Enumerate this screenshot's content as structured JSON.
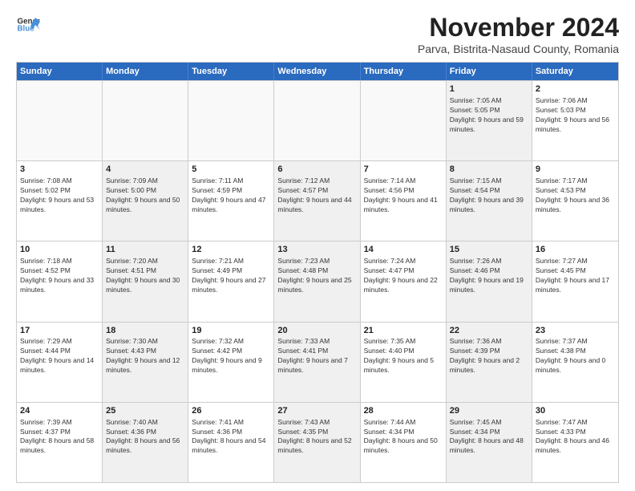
{
  "logo": {
    "line1": "General",
    "line2": "Blue"
  },
  "title": "November 2024",
  "subtitle": "Parva, Bistrita-Nasaud County, Romania",
  "header_days": [
    "Sunday",
    "Monday",
    "Tuesday",
    "Wednesday",
    "Thursday",
    "Friday",
    "Saturday"
  ],
  "rows": [
    {
      "cells": [
        {
          "day": "",
          "info": "",
          "empty": true
        },
        {
          "day": "",
          "info": "",
          "empty": true
        },
        {
          "day": "",
          "info": "",
          "empty": true
        },
        {
          "day": "",
          "info": "",
          "empty": true
        },
        {
          "day": "",
          "info": "",
          "empty": true
        },
        {
          "day": "1",
          "info": "Sunrise: 7:05 AM\nSunset: 5:05 PM\nDaylight: 9 hours and 59 minutes.",
          "shaded": true
        },
        {
          "day": "2",
          "info": "Sunrise: 7:06 AM\nSunset: 5:03 PM\nDaylight: 9 hours and 56 minutes.",
          "shaded": false
        }
      ]
    },
    {
      "cells": [
        {
          "day": "3",
          "info": "Sunrise: 7:08 AM\nSunset: 5:02 PM\nDaylight: 9 hours and 53 minutes.",
          "shaded": false
        },
        {
          "day": "4",
          "info": "Sunrise: 7:09 AM\nSunset: 5:00 PM\nDaylight: 9 hours and 50 minutes.",
          "shaded": true
        },
        {
          "day": "5",
          "info": "Sunrise: 7:11 AM\nSunset: 4:59 PM\nDaylight: 9 hours and 47 minutes.",
          "shaded": false
        },
        {
          "day": "6",
          "info": "Sunrise: 7:12 AM\nSunset: 4:57 PM\nDaylight: 9 hours and 44 minutes.",
          "shaded": true
        },
        {
          "day": "7",
          "info": "Sunrise: 7:14 AM\nSunset: 4:56 PM\nDaylight: 9 hours and 41 minutes.",
          "shaded": false
        },
        {
          "day": "8",
          "info": "Sunrise: 7:15 AM\nSunset: 4:54 PM\nDaylight: 9 hours and 39 minutes.",
          "shaded": true
        },
        {
          "day": "9",
          "info": "Sunrise: 7:17 AM\nSunset: 4:53 PM\nDaylight: 9 hours and 36 minutes.",
          "shaded": false
        }
      ]
    },
    {
      "cells": [
        {
          "day": "10",
          "info": "Sunrise: 7:18 AM\nSunset: 4:52 PM\nDaylight: 9 hours and 33 minutes.",
          "shaded": false
        },
        {
          "day": "11",
          "info": "Sunrise: 7:20 AM\nSunset: 4:51 PM\nDaylight: 9 hours and 30 minutes.",
          "shaded": true
        },
        {
          "day": "12",
          "info": "Sunrise: 7:21 AM\nSunset: 4:49 PM\nDaylight: 9 hours and 27 minutes.",
          "shaded": false
        },
        {
          "day": "13",
          "info": "Sunrise: 7:23 AM\nSunset: 4:48 PM\nDaylight: 9 hours and 25 minutes.",
          "shaded": true
        },
        {
          "day": "14",
          "info": "Sunrise: 7:24 AM\nSunset: 4:47 PM\nDaylight: 9 hours and 22 minutes.",
          "shaded": false
        },
        {
          "day": "15",
          "info": "Sunrise: 7:26 AM\nSunset: 4:46 PM\nDaylight: 9 hours and 19 minutes.",
          "shaded": true
        },
        {
          "day": "16",
          "info": "Sunrise: 7:27 AM\nSunset: 4:45 PM\nDaylight: 9 hours and 17 minutes.",
          "shaded": false
        }
      ]
    },
    {
      "cells": [
        {
          "day": "17",
          "info": "Sunrise: 7:29 AM\nSunset: 4:44 PM\nDaylight: 9 hours and 14 minutes.",
          "shaded": false
        },
        {
          "day": "18",
          "info": "Sunrise: 7:30 AM\nSunset: 4:43 PM\nDaylight: 9 hours and 12 minutes.",
          "shaded": true
        },
        {
          "day": "19",
          "info": "Sunrise: 7:32 AM\nSunset: 4:42 PM\nDaylight: 9 hours and 9 minutes.",
          "shaded": false
        },
        {
          "day": "20",
          "info": "Sunrise: 7:33 AM\nSunset: 4:41 PM\nDaylight: 9 hours and 7 minutes.",
          "shaded": true
        },
        {
          "day": "21",
          "info": "Sunrise: 7:35 AM\nSunset: 4:40 PM\nDaylight: 9 hours and 5 minutes.",
          "shaded": false
        },
        {
          "day": "22",
          "info": "Sunrise: 7:36 AM\nSunset: 4:39 PM\nDaylight: 9 hours and 2 minutes.",
          "shaded": true
        },
        {
          "day": "23",
          "info": "Sunrise: 7:37 AM\nSunset: 4:38 PM\nDaylight: 9 hours and 0 minutes.",
          "shaded": false
        }
      ]
    },
    {
      "cells": [
        {
          "day": "24",
          "info": "Sunrise: 7:39 AM\nSunset: 4:37 PM\nDaylight: 8 hours and 58 minutes.",
          "shaded": false
        },
        {
          "day": "25",
          "info": "Sunrise: 7:40 AM\nSunset: 4:36 PM\nDaylight: 8 hours and 56 minutes.",
          "shaded": true
        },
        {
          "day": "26",
          "info": "Sunrise: 7:41 AM\nSunset: 4:36 PM\nDaylight: 8 hours and 54 minutes.",
          "shaded": false
        },
        {
          "day": "27",
          "info": "Sunrise: 7:43 AM\nSunset: 4:35 PM\nDaylight: 8 hours and 52 minutes.",
          "shaded": true
        },
        {
          "day": "28",
          "info": "Sunrise: 7:44 AM\nSunset: 4:34 PM\nDaylight: 8 hours and 50 minutes.",
          "shaded": false
        },
        {
          "day": "29",
          "info": "Sunrise: 7:45 AM\nSunset: 4:34 PM\nDaylight: 8 hours and 48 minutes.",
          "shaded": true
        },
        {
          "day": "30",
          "info": "Sunrise: 7:47 AM\nSunset: 4:33 PM\nDaylight: 8 hours and 46 minutes.",
          "shaded": false
        }
      ]
    }
  ]
}
